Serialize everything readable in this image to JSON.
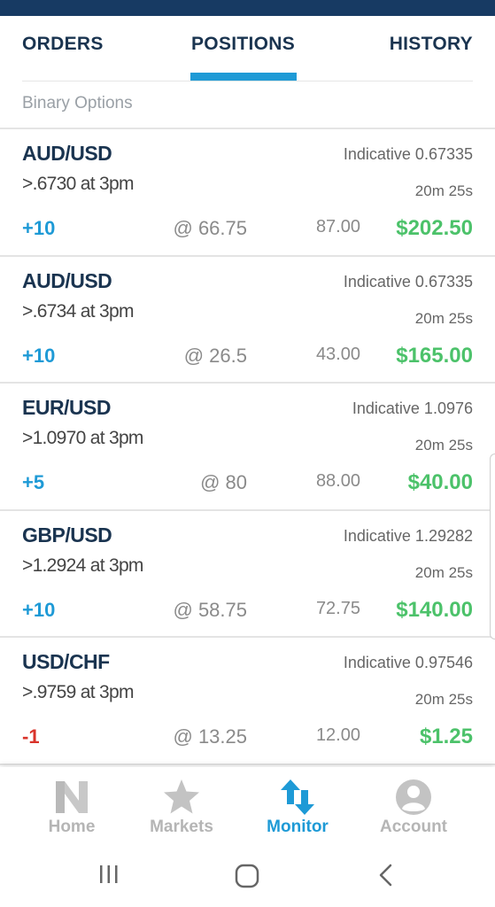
{
  "tabs": [
    {
      "label": "ORDERS"
    },
    {
      "label": "POSITIONS",
      "active": true
    },
    {
      "label": "HISTORY"
    }
  ],
  "section_label": "Binary Options",
  "positions": [
    {
      "pair": "AUD/USD",
      "indicative": "Indicative 0.67335",
      "strike": ">.6730 at 3pm",
      "timer": "20m 25s",
      "quantity": "+10",
      "price": "@ 66.75",
      "bid": "87.00",
      "value": "$202.50"
    },
    {
      "pair": "AUD/USD",
      "indicative": "Indicative 0.67335",
      "strike": ">.6734 at 3pm",
      "timer": "20m 25s",
      "quantity": "+10",
      "price": "@ 26.5",
      "bid": "43.00",
      "value": "$165.00"
    },
    {
      "pair": "EUR/USD",
      "indicative": "Indicative 1.0976",
      "strike": ">1.0970 at 3pm",
      "timer": "20m 25s",
      "quantity": "+5",
      "price": "@ 80",
      "bid": "88.00",
      "value": "$40.00"
    },
    {
      "pair": "GBP/USD",
      "indicative": "Indicative 1.29282",
      "strike": ">1.2924 at 3pm",
      "timer": "20m 25s",
      "quantity": "+10",
      "price": "@ 58.75",
      "bid": "72.75",
      "value": "$140.00"
    },
    {
      "pair": "USD/CHF",
      "indicative": "Indicative 0.97546",
      "strike": ">.9759 at 3pm",
      "timer": "20m 25s",
      "quantity": "-1",
      "price": "@ 13.25",
      "bid": "12.00",
      "value": "$1.25"
    }
  ],
  "bottom_nav": [
    {
      "label": "Home",
      "icon": "n-logo-icon"
    },
    {
      "label": "Markets",
      "icon": "star-icon"
    },
    {
      "label": "Monitor",
      "icon": "up-down-arrows-icon",
      "active": true
    },
    {
      "label": "Account",
      "icon": "user-icon"
    }
  ],
  "colors": {
    "header_bar": "#173a63",
    "accent_blue": "#1e9ad6",
    "positive_green": "#4cc26a",
    "negative_red": "#d9342b",
    "dark_text": "#1a3450"
  }
}
